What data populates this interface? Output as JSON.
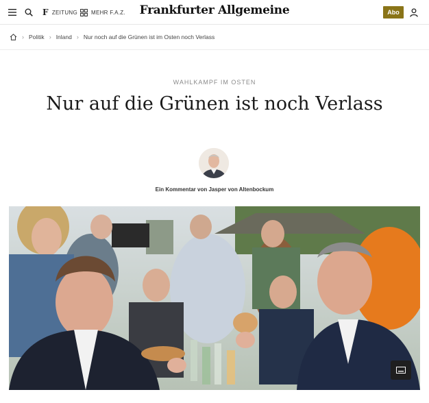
{
  "header": {
    "zeitung_label": "ZEITUNG",
    "mehr_label": "MEHR F.A.Z.",
    "logo_text": "Frankfurter Allgemeine",
    "abo_label": "Abo",
    "icons": [
      "menu-icon",
      "search-icon",
      "faz-f-icon",
      "grid-icon",
      "user-icon"
    ]
  },
  "breadcrumb": {
    "items": [
      "Politik",
      "Inland",
      "Nur noch auf die Grünen ist im Osten noch Verlass"
    ],
    "home_icon": "home-icon"
  },
  "article": {
    "kicker": "WAHLKAMPF IM OSTEN",
    "headline": "Nur auf die Grünen ist noch Verlass",
    "byline": "Ein Kommentar von Jasper von Altenbockum"
  },
  "colors": {
    "abo_background": "#8a7418",
    "text": "#1a1a1a",
    "kicker": "#8a8a8a"
  }
}
